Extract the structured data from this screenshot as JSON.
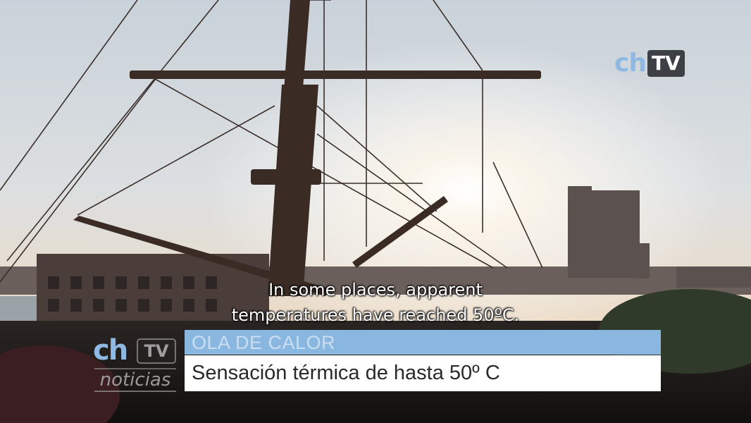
{
  "channel_logo": {
    "ch": "ch",
    "tv": "TV"
  },
  "subtitles": {
    "line1": "In some places, apparent",
    "line2": "temperatures have reached 50ºC."
  },
  "program_logo": {
    "ch": "ch",
    "tv": "TV",
    "name": "noticias"
  },
  "lower_third": {
    "headline": "OLA DE CALOR",
    "caption": "Sensación térmica de hasta 50º C"
  },
  "colors": {
    "brand_blue": "#8ab7e0",
    "logo_gray": "#3d4045",
    "caption_bg": "#ffffff"
  }
}
